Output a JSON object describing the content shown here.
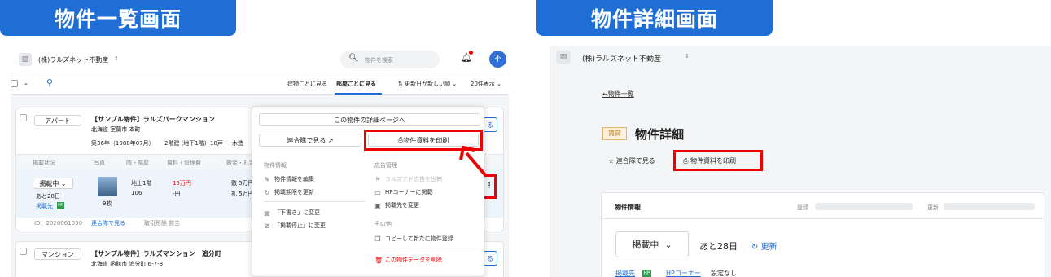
{
  "banners": {
    "list": "物件一覧画面",
    "detail": "物件詳細画面"
  },
  "left": {
    "company": "(株)ラルズネット不動産",
    "search_placeholder": "物件を検索",
    "avatar": "不",
    "view_by_building": "建物ごとに見る",
    "view_by_room": "部屋ごとに見る",
    "sort": "更新日が新しい順",
    "per_page": "20件表示",
    "card1": {
      "type": "アパート",
      "title": "【サンプル物件】ラルズパークマンション",
      "address": "北海道 室蘭市 本町",
      "age": "築36年（1988年07月）",
      "floor": "2階建 (地下1階)",
      "units": "18戸",
      "structure": "木造",
      "cols": [
        "掲載状況",
        "写真",
        "階・部屋",
        "賃料・管理費",
        "敷金・礼金"
      ],
      "status": "掲載中",
      "remain": "あと28日",
      "published": "掲載先",
      "hp_badge": "HP",
      "photo_count": "9枚",
      "floor_label": "地上1階",
      "room": "106",
      "rent": "15万円",
      "fee": "-円",
      "deposit1": "敷 5万円",
      "deposit2": "礼 5万円",
      "id": "ID：2020061050",
      "dash": "--",
      "rengo_link": "連合隊で見る",
      "deal": "取引形態 貸主"
    },
    "card2": {
      "type": "マンション",
      "title": "【サンプル物件】ラルズマンション　追分町",
      "address": "北海道 函館市 追分町 6-7-8"
    },
    "edge_btn": "る",
    "kebab": "⋮",
    "menu": {
      "detail": "この物件の詳細ページへ",
      "rengo": "連合隊で見る",
      "print": "物件資料を印刷",
      "sec_info": "物件情報",
      "edit": "物件情報を編集",
      "renew": "掲載期限を更新",
      "draft": "「下書き」に変更",
      "stop": "「掲載停止」に変更",
      "sec_ad": "広告管理",
      "ralz_ad": "ラルズアド広告を出稿",
      "hp_corner": "HPコーナーに掲載",
      "change_dest": "掲載先を変更",
      "sec_other": "その他",
      "copy": "コピーして新たに物件登録",
      "delete": "この物件データを削除"
    }
  },
  "right": {
    "company": "(株)ラルズネット不動産",
    "back": "←物件一覧",
    "badge": "賃貸",
    "title": "物件詳細",
    "rengo": "連合隊で見る",
    "print": "物件資料を印刷",
    "info_title": "物件情報",
    "registered": "登録",
    "updated": "更新",
    "status": "掲載中",
    "remain": "あと28日",
    "renew": "更新",
    "published": "掲載先",
    "hp_badge": "HP",
    "hp_corner": "HPコーナー",
    "no_setting": "設定なし"
  },
  "colors": {
    "accent": "#1e6ed6",
    "highlight": "#e00000",
    "green": "#2e9b4f"
  }
}
